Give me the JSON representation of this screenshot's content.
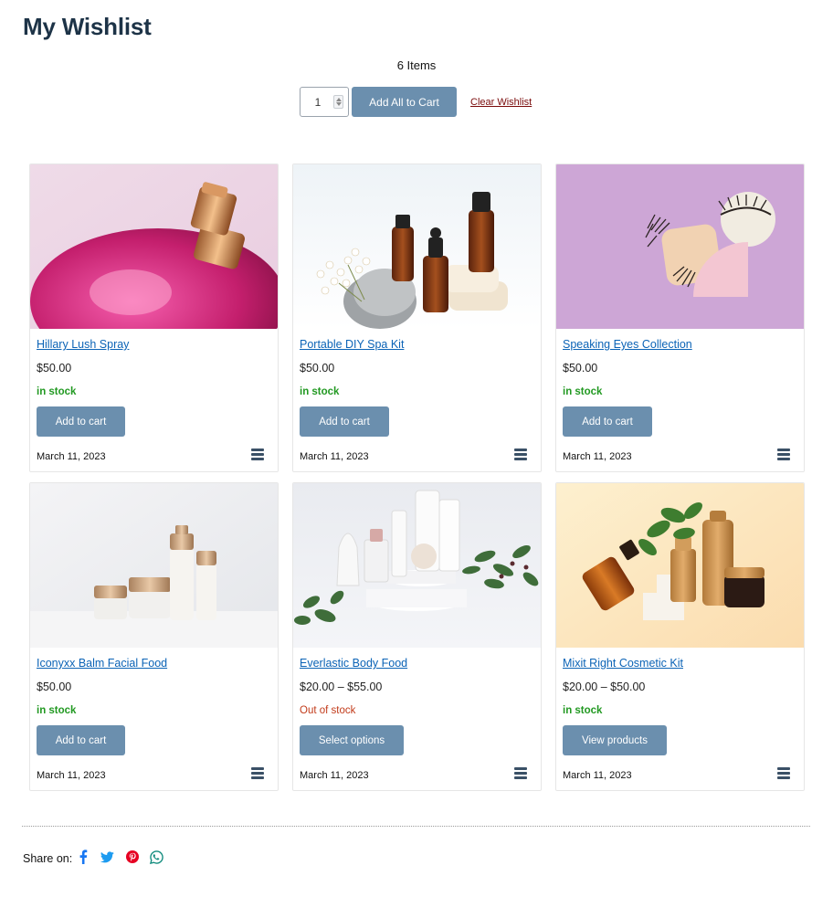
{
  "page": {
    "title": "My Wishlist",
    "items_count": "6 Items"
  },
  "toolbar": {
    "quantity": "1",
    "add_all_label": "Add All to Cart",
    "clear_label": "Clear Wishlist"
  },
  "products": [
    {
      "name": "Hillary Lush Spray",
      "price": "$50.00",
      "stock": "in stock",
      "action": "Add to cart",
      "date": "March 11, 2023",
      "image_icon": "perfume-bottle-image"
    },
    {
      "name": "Portable DIY Spa Kit",
      "price": "$50.00",
      "stock": "in stock",
      "action": "Add to cart",
      "date": "March 11, 2023",
      "image_icon": "spa-kit-image"
    },
    {
      "name": "Speaking Eyes Collection",
      "price": "$50.00",
      "stock": "in stock",
      "action": "Add to cart",
      "date": "March 11, 2023",
      "image_icon": "eyelashes-image"
    },
    {
      "name": "Iconyxx Balm Facial Food",
      "price": "$50.00",
      "stock": "in stock",
      "action": "Add to cart",
      "date": "March 11, 2023",
      "image_icon": "cream-jars-image"
    },
    {
      "name": "Everlastic Body Food",
      "price": "$20.00 – $55.00",
      "stock": "Out of stock",
      "action": "Select options",
      "date": "March 11, 2023",
      "image_icon": "body-care-image"
    },
    {
      "name": "Mixit Right Cosmetic Kit",
      "price": "$20.00 – $50.00",
      "stock": "in stock",
      "action": "View products",
      "date": "March 11, 2023",
      "image_icon": "cosmetic-kit-image"
    }
  ],
  "share": {
    "label": "Share on:",
    "networks": [
      "facebook-icon",
      "twitter-icon",
      "pinterest-icon",
      "whatsapp-icon"
    ]
  },
  "colors": {
    "accent_button": "#6b8fae",
    "link": "#0b63b6",
    "in_stock": "#229922",
    "out_of_stock": "#c23b1a",
    "title": "#1d3347",
    "clear_link": "#7a0b0b"
  }
}
